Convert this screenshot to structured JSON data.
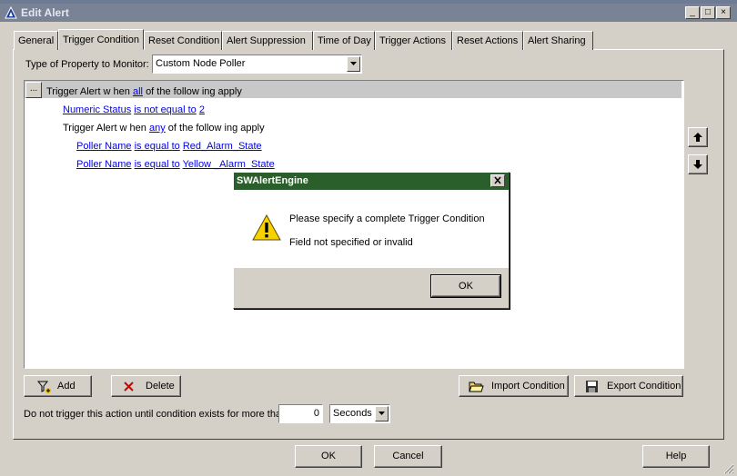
{
  "window": {
    "title": "Edit Alert",
    "minimize": "_",
    "maximize": "□",
    "close": "×"
  },
  "tabs": [
    {
      "label": "General"
    },
    {
      "label": "Trigger Condition"
    },
    {
      "label": "Reset Condition"
    },
    {
      "label": "Alert Suppression"
    },
    {
      "label": "Time of Day"
    },
    {
      "label": "Trigger Actions"
    },
    {
      "label": "Reset Actions"
    },
    {
      "label": "Alert Sharing"
    }
  ],
  "property": {
    "label": "Type of Property to Monitor:",
    "value": "Custom Node Poller"
  },
  "conditions": {
    "menu_button": "...",
    "root": {
      "prefix": "Trigger Alert w hen",
      "quantifier": "all",
      "suffix": "of the follow ing apply"
    },
    "c1": {
      "field": "Numeric Status",
      "operator": "is not equal to",
      "value": "2"
    },
    "group": {
      "prefix": "Trigger Alert w hen",
      "quantifier": "any",
      "suffix": "of the follow ing apply"
    },
    "c2": {
      "field": "Poller Name",
      "operator": "is equal to",
      "value": "Red_Alarm_State"
    },
    "c3": {
      "field": "Poller Name",
      "operator": "is equal to",
      "value": "Yellow _Alarm_State"
    }
  },
  "buttons": {
    "add": "Add",
    "delete": "Delete",
    "import": "Import Condition",
    "export": "Export Condition",
    "ok": "OK",
    "cancel": "Cancel",
    "help": "Help"
  },
  "delay": {
    "label": "Do not trigger this action until condition exists for more than",
    "value": "0",
    "unit": "Seconds"
  },
  "dialog": {
    "title": "SWAlertEngine",
    "close": "×",
    "message": "Please specify a complete Trigger Condition",
    "detail": "Field not specified or invalid",
    "ok": "OK"
  },
  "colors": {
    "link": "#0000ee",
    "dialog_title": "#2a5e2a",
    "titlebar": "#7a8396"
  }
}
